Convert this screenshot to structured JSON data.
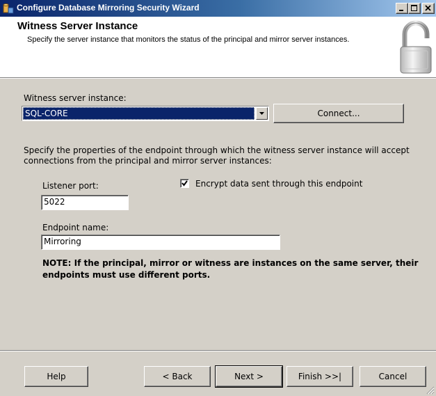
{
  "window": {
    "title": "Configure Database Mirroring Security Wizard",
    "app_icon": "sql-server-wizard-icon",
    "controls": [
      "minimize-icon",
      "maximize-icon",
      "close-icon"
    ]
  },
  "header": {
    "title": "Witness Server Instance",
    "description": "Specify the server instance that monitors the status of the principal and mirror server instances.",
    "image": "padlock-icon"
  },
  "witness": {
    "label": "Witness server instance:",
    "selected_value": "SQL-CORE",
    "connect_label": "Connect..."
  },
  "endpoint": {
    "description": "Specify the properties of the endpoint through which the witness server instance will accept connections from the principal and mirror server instances:",
    "listener_port_label": "Listener port:",
    "listener_port_value": "5022",
    "encrypt_label": "Encrypt data sent through this endpoint",
    "encrypt_checked": true,
    "name_label": "Endpoint name:",
    "name_value": "Mirroring",
    "note": "NOTE: If the principal, mirror or witness are instances on the same server, their endpoints must use different ports."
  },
  "footer": {
    "help_label": "Help",
    "back_label": "< Back",
    "next_label": "Next >",
    "finish_label": "Finish >>|",
    "cancel_label": "Cancel"
  },
  "colors": {
    "title_gradient_start": "#0a246a",
    "title_gradient_end": "#a6caf0",
    "selection": "#0a246a",
    "face": "#d4d0c8"
  }
}
